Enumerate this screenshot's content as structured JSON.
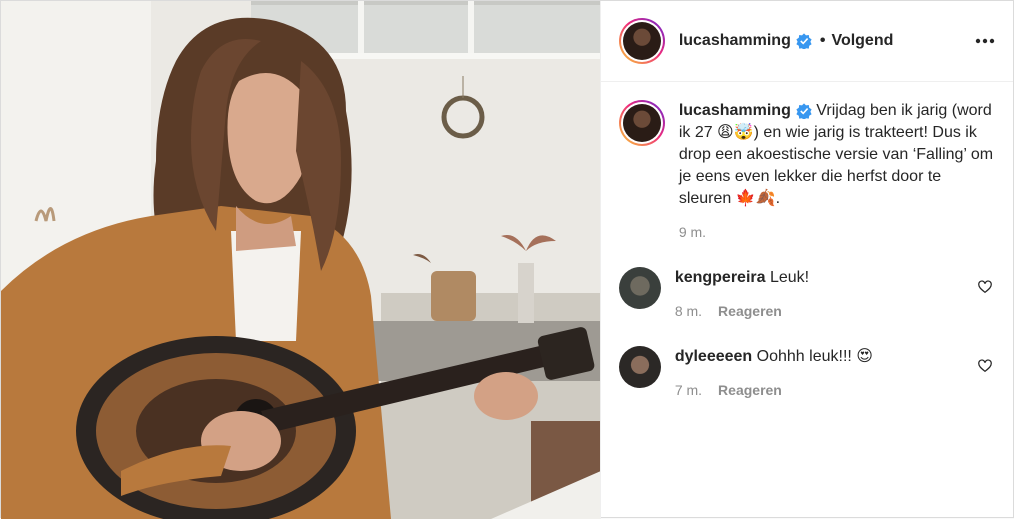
{
  "post": {
    "author": "lucashamming",
    "follow_label": "Volgend",
    "separator": "•",
    "caption": {
      "username": "lucashamming",
      "text": "Vrijdag ben ik jarig (word ik 27 😩🤯) en wie jarig is trakteert! Dus ik drop een akoestische versie van ‘Falling’ om je eens even lekker die herfst door te sleuren 🍁🍂.",
      "time": "9 m."
    },
    "comments": [
      {
        "username": "kengpereira",
        "text": "Leuk!",
        "time": "8 m.",
        "reply_label": "Reageren"
      },
      {
        "username": "dyleeeeen",
        "text": "Oohhh leuk!!! 😍",
        "time": "7 m.",
        "reply_label": "Reageren"
      }
    ]
  },
  "icons": {
    "verified": "verified-badge-icon",
    "more": "more-options-icon",
    "like": "heart-icon"
  },
  "colors": {
    "verified": "#3897f0",
    "muted": "#8e8e8e",
    "text": "#262626"
  }
}
